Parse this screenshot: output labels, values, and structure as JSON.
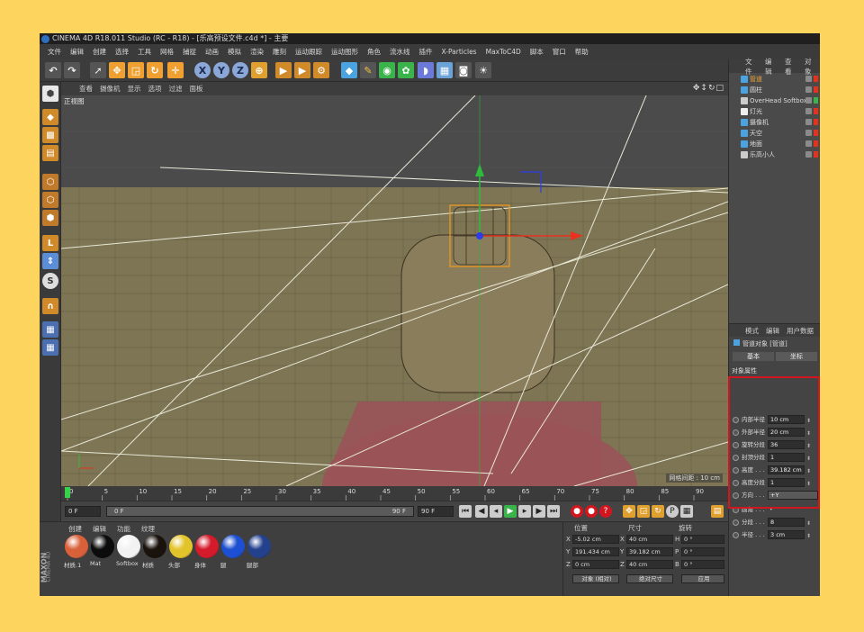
{
  "window": {
    "title": "CINEMA 4D R18.011 Studio (RC - R18) - [乐高预设文件.c4d *] - 主要"
  },
  "menu": [
    "文件",
    "编辑",
    "创建",
    "选择",
    "工具",
    "网格",
    "捕捉",
    "动画",
    "模拟",
    "渲染",
    "雕刻",
    "运动跟踪",
    "运动图形",
    "角色",
    "流水线",
    "插件",
    "X-Particles",
    "MaxToC4D",
    "脚本",
    "窗口",
    "帮助"
  ],
  "toolbar": {
    "items": [
      "undo-icon",
      "redo-icon",
      "live-select-icon",
      "move-icon",
      "scale-icon",
      "rotate-icon",
      "move-icon",
      "x-axis-icon",
      "y-axis-icon",
      "z-axis-icon",
      "world-coordinates-icon",
      "render-view-icon",
      "render-picture-viewer-icon",
      "render-settings-icon",
      "cube-icon",
      "pen-icon",
      "subdivision-icon",
      "array-icon",
      "deformer-icon",
      "floor-icon",
      "camera-icon",
      "light-icon"
    ],
    "axis": [
      "X",
      "Y",
      "Z"
    ]
  },
  "viewport": {
    "menu": [
      "查看",
      "摄像机",
      "显示",
      "选项",
      "过滤",
      "面板"
    ],
    "label": "正视图",
    "grid_size": "网格间距 : 10 cm",
    "colors": {
      "background_top": "#4b4b4b",
      "floor": "#7d7553",
      "grid": "#6a6546",
      "shirt": "#9a5358",
      "head": "#8a7d5b",
      "selection": "#f29a1c",
      "x_axis": "#e8321f",
      "y_axis": "#2ebd3a",
      "z_axis": "#2d3ce8"
    }
  },
  "timeline": {
    "ticks": [
      "0",
      "5",
      "10",
      "15",
      "20",
      "25",
      "30",
      "35",
      "40",
      "45",
      "50",
      "55",
      "60",
      "65",
      "70",
      "75",
      "80",
      "85",
      "90"
    ],
    "current_frame_field": "0 F",
    "start_field": "0 F",
    "slider_start": "0 F",
    "slider_end": "90 F",
    "end_field": "90 F",
    "playhead_frame": 0,
    "range": [
      0,
      90
    ]
  },
  "materials": {
    "menu": [
      "创建",
      "编辑",
      "功能",
      "纹理"
    ],
    "items": [
      {
        "name": "材质.1",
        "color": "#d8613a"
      },
      {
        "name": "Mat",
        "color": "#0c0c0c"
      },
      {
        "name": "Softbox",
        "color": "#f2f2f2"
      },
      {
        "name": "材质",
        "color": "#1a120c"
      },
      {
        "name": "头部",
        "color": "#e2c42a"
      },
      {
        "name": "身体",
        "color": "#d41a2b"
      },
      {
        "name": "腿",
        "color": "#1c4fd1"
      },
      {
        "name": "腿部",
        "color": "#24418e"
      }
    ],
    "brand_top": "MAXON",
    "brand_bottom": "CINEMA 4D"
  },
  "coordinates": {
    "headers": [
      "位置",
      "尺寸",
      "旋转"
    ],
    "rows": [
      {
        "axis": "X",
        "pos": "-5.02 cm",
        "size_axis": "X",
        "size": "40 cm",
        "rot_axis": "H",
        "rot": "0 °"
      },
      {
        "axis": "Y",
        "pos": "191.434 cm",
        "size_axis": "Y",
        "size": "39.182 cm",
        "rot_axis": "P",
        "rot": "0 °"
      },
      {
        "axis": "Z",
        "pos": "0 cm",
        "size_axis": "Z",
        "size": "40 cm",
        "rot_axis": "B",
        "rot": "0 °"
      }
    ],
    "mode_select": "对象 (相对)",
    "size_select": "绝对尺寸",
    "apply_button": "应用"
  },
  "object_manager": {
    "menu": [
      "文件",
      "编辑",
      "查看",
      "对象"
    ],
    "items": [
      {
        "name": "管道",
        "icon": "tube-icon",
        "selected": true,
        "tag_color": "#e3331f"
      },
      {
        "name": "圆柱",
        "icon": "cylinder-icon",
        "selected": false,
        "tag_color": "#e3331f"
      },
      {
        "name": "OverHead Softbox",
        "icon": "null-group-icon",
        "selected": false,
        "tag_color": "#3ab34a"
      },
      {
        "name": "灯光",
        "icon": "light-icon",
        "selected": false,
        "tag_color": "#e3331f"
      },
      {
        "name": "摄像机",
        "icon": "camera-icon",
        "selected": false,
        "tag_color": "#e3331f"
      },
      {
        "name": "天空",
        "icon": "sky-icon",
        "selected": false,
        "tag_color": "#e3331f"
      },
      {
        "name": "地面",
        "icon": "floor-icon",
        "selected": false,
        "tag_color": "#e3331f"
      },
      {
        "name": "乐高小人",
        "icon": "null-group-icon",
        "selected": false,
        "tag_color": "#e3331f"
      }
    ]
  },
  "attributes": {
    "menu": [
      "模式",
      "编辑",
      "用户数据"
    ],
    "title": "管道对象 [管道]",
    "tabs": [
      "基本",
      "坐标"
    ],
    "section": "对象属性",
    "fields": [
      {
        "label": "内部半径",
        "value": "10 cm"
      },
      {
        "label": "外部半径",
        "value": "20 cm"
      },
      {
        "label": "旋转分段",
        "value": "36"
      },
      {
        "label": "封顶分段",
        "value": "1"
      },
      {
        "label": "高度 . . .",
        "value": "39.182 cm"
      },
      {
        "label": "高度分段",
        "value": "1"
      },
      {
        "label": "方向 . . .",
        "value": "+Y"
      },
      {
        "label": "圆角 . . .",
        "value": "✓"
      },
      {
        "label": "分段 . . .",
        "value": "8"
      },
      {
        "label": "半径 . . .",
        "value": "3 cm"
      }
    ]
  },
  "highlight_color": "#d2161f"
}
